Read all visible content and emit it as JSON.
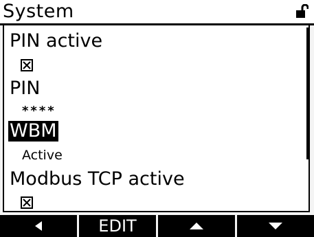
{
  "header": {
    "title": "System",
    "lock_icon": "unlocked-padlock-icon"
  },
  "items": [
    {
      "label": "PIN active",
      "value_type": "checkbox",
      "checked": true,
      "selected": false
    },
    {
      "label": "PIN",
      "value": "****",
      "selected": false
    },
    {
      "label": "WBM",
      "value": "Active",
      "selected": true
    },
    {
      "label": "Modbus TCP active",
      "value_type": "checkbox",
      "checked": true,
      "selected": false
    }
  ],
  "softkeys": {
    "left_icon": "triangle-left-icon",
    "edit_label": "EDIT",
    "up_icon": "triangle-up-icon",
    "down_icon": "triangle-down-icon"
  },
  "colors": {
    "foreground": "#000000",
    "background": "#ffffff"
  }
}
